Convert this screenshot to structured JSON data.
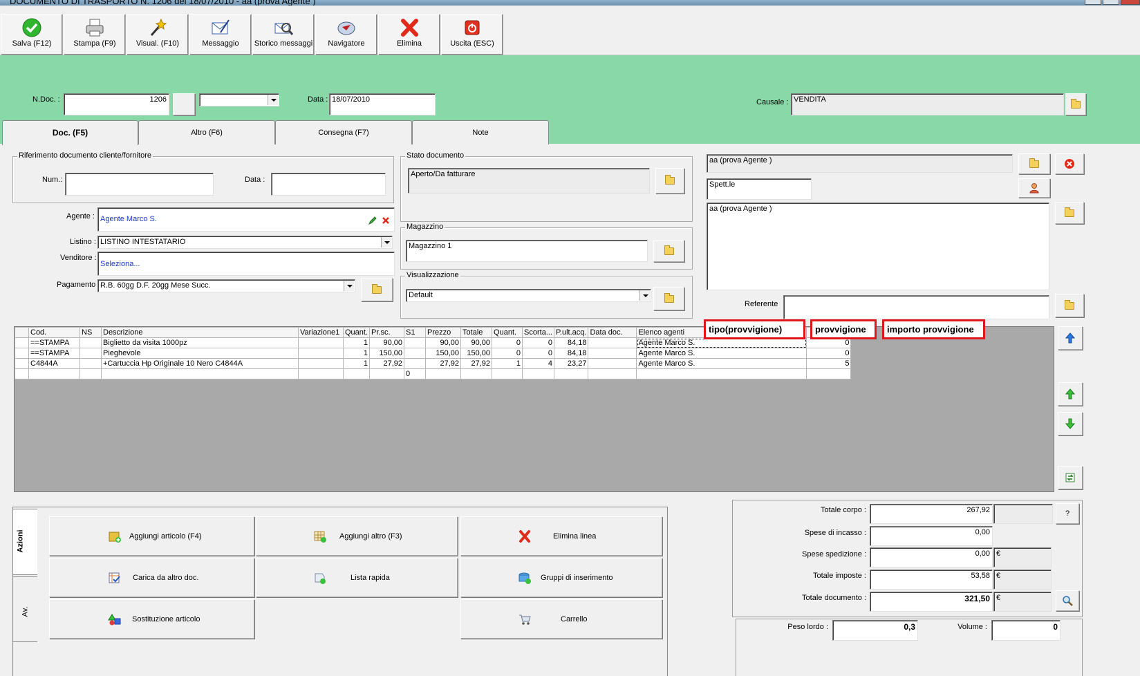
{
  "window": {
    "title": "DOCUMENTO DI TRASPORTO N. 1206  del 18/07/2010 - aa (prova Agente )"
  },
  "toolbar": [
    {
      "label": "Salva (F12)",
      "icon": "check-icon"
    },
    {
      "label": "Stampa (F9)",
      "icon": "printer-icon"
    },
    {
      "label": "Visual. (F10)",
      "icon": "magic-wand-icon"
    },
    {
      "label": "Messaggio",
      "icon": "message-icon"
    },
    {
      "label": "Storico messaggi",
      "icon": "history-icon"
    },
    {
      "label": "Navigatore",
      "icon": "compass-icon"
    },
    {
      "label": "Elimina",
      "icon": "delete-x-icon"
    },
    {
      "label": "Uscita (ESC)",
      "icon": "power-icon"
    }
  ],
  "header": {
    "ndoc_label": "N.Doc. :",
    "ndoc_value": "1206",
    "data_label": "Data :",
    "data_value": "18/07/2010",
    "causale_label": "Causale :",
    "causale_value": "VENDITA"
  },
  "tabs": [
    "Doc. (F5)",
    "Altro (F6)",
    "Consegna (F7)",
    "Note"
  ],
  "riferimento": {
    "title": "Riferimento documento cliente/fornitore",
    "num_label": "Num.:",
    "data_label": "Data :"
  },
  "stato": {
    "title": "Stato documento",
    "value": "Aperto/Da fatturare"
  },
  "magazzino": {
    "title": "Magazzino",
    "value": "Magazzino 1"
  },
  "visualizzazione": {
    "title": "Visualizzazione",
    "value": "Default"
  },
  "form": {
    "agente_label": "Agente :",
    "agente_value": "Agente Marco S.",
    "listino_label": "Listino :",
    "listino_value": "LISTINO INTESTATARIO",
    "venditore_label": "Venditore :",
    "venditore_value": "Seleziona...",
    "pagamento_label": "Pagamento :",
    "pagamento_value": "R.B. 60gg D.F. 20gg Mese Succ."
  },
  "cliente": {
    "name": "aa (prova Agente )",
    "salutation": "Spett.le",
    "address": "aa (prova Agente )",
    "referente_label": "Referente"
  },
  "grid": {
    "columns": [
      "Cod.",
      "NS",
      "Descrizione",
      "Variazione1",
      "Quant.",
      "Pr.sc.",
      "S1",
      "Prezzo",
      "Totale",
      "Quant.",
      "Scorta...",
      "P.ult.acq.",
      "Data doc.",
      "Elenco agenti",
      ""
    ],
    "rows": [
      [
        "==STAMPA",
        "",
        "Biglietto da visita 1000pz",
        "",
        "1",
        "90,00",
        "",
        "90,00",
        "90,00",
        "0",
        "0",
        "84,18",
        "",
        "Agente Marco S.",
        "0"
      ],
      [
        "==STAMPA",
        "",
        "Pieghevole",
        "",
        "1",
        "150,00",
        "",
        "150,00",
        "150,00",
        "0",
        "0",
        "84,18",
        "",
        "Agente Marco S.",
        "0"
      ],
      [
        "C4844A",
        "",
        "+Cartuccia Hp Originale 10 Nero C4844A",
        "",
        "1",
        "27,92",
        "",
        "27,92",
        "27,92",
        "1",
        "4",
        "23,27",
        "",
        "Agente Marco S.",
        "5"
      ],
      [
        "",
        "",
        "",
        "",
        "",
        "",
        "0",
        "",
        "",
        "",
        "",
        "",
        "",
        "",
        ""
      ]
    ]
  },
  "annotations": [
    "tipo(provvigione)",
    "provvigione",
    "importo provvigione"
  ],
  "actions": {
    "side_tabs": [
      "Azioni",
      "Av."
    ],
    "buttons": [
      {
        "label": "Aggiungi articolo (F4)",
        "icon": "box-add-icon"
      },
      {
        "label": "Aggiungi altro (F3)",
        "icon": "grid-add-icon"
      },
      {
        "label": "Elimina linea",
        "icon": "delete-x-icon"
      },
      {
        "label": "Carica da altro doc.",
        "icon": "load-doc-icon"
      },
      {
        "label": "Lista rapida",
        "icon": "quick-list-icon"
      },
      {
        "label": "Gruppi di inserimento",
        "icon": "group-insert-icon"
      },
      {
        "label": "Sostituzione articolo",
        "icon": "replace-icon"
      },
      {
        "label": "Carrello",
        "icon": "cart-icon"
      }
    ]
  },
  "totals": {
    "totale_corpo_label": "Totale corpo :",
    "totale_corpo": "267,92",
    "spese_incasso_label": "Spese di incasso :",
    "spese_incasso": "0,00",
    "spese_spedizione_label": "Spese spedizione :",
    "spese_spedizione": "0,00",
    "totale_imposte_label": "Totale imposte :",
    "totale_imposte": "53,58",
    "totale_documento_label": "Totale documento :",
    "totale_documento": "321,50",
    "currency": "€",
    "help": "?",
    "peso_label": "Peso lordo :",
    "peso": "0,3",
    "volume_label": "Volume :",
    "volume": "0"
  }
}
